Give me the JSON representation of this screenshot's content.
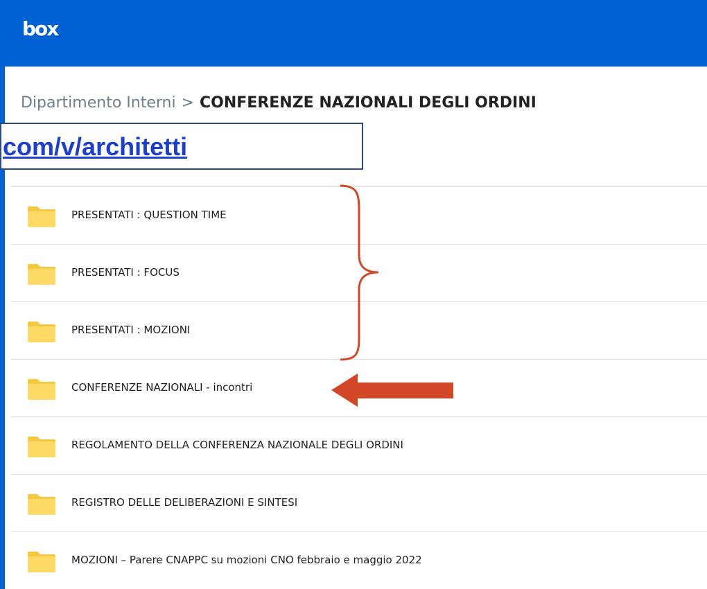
{
  "app": {
    "logo_text": "box",
    "brand_color": "#0061d5"
  },
  "breadcrumb": {
    "parent": "Dipartimento Interni",
    "separator": ">",
    "current": "CONFERENZE NAZIONALI DEGLI ORDINI"
  },
  "url_banner": {
    "text": "com/v/architetti",
    "color": "#1a3fd1"
  },
  "folders": [
    {
      "name": "PRESENTATI : QUESTION TIME",
      "icon": "folder-icon"
    },
    {
      "name": "PRESENTATI : FOCUS",
      "icon": "folder-icon"
    },
    {
      "name": "PRESENTATI : MOZIONI",
      "icon": "folder-icon"
    },
    {
      "name": "CONFERENZE NAZIONALI - incontri",
      "icon": "folder-icon"
    },
    {
      "name": "REGOLAMENTO DELLA CONFERENZA NAZIONALE DEGLI ORDINI",
      "icon": "folder-icon"
    },
    {
      "name": "REGISTRO DELLE DELIBERAZIONI E SINTESI",
      "icon": "folder-icon"
    },
    {
      "name": "MOZIONI – Parere CNAPPC su mozioni CNO febbraio e maggio 2022",
      "icon": "folder-icon"
    }
  ],
  "annotations": {
    "brace": "right-curly-brace",
    "arrow": "left-arrow",
    "color": "#d24726"
  },
  "colors": {
    "folder": "#ffd966",
    "folder_tab": "#f5c842"
  }
}
